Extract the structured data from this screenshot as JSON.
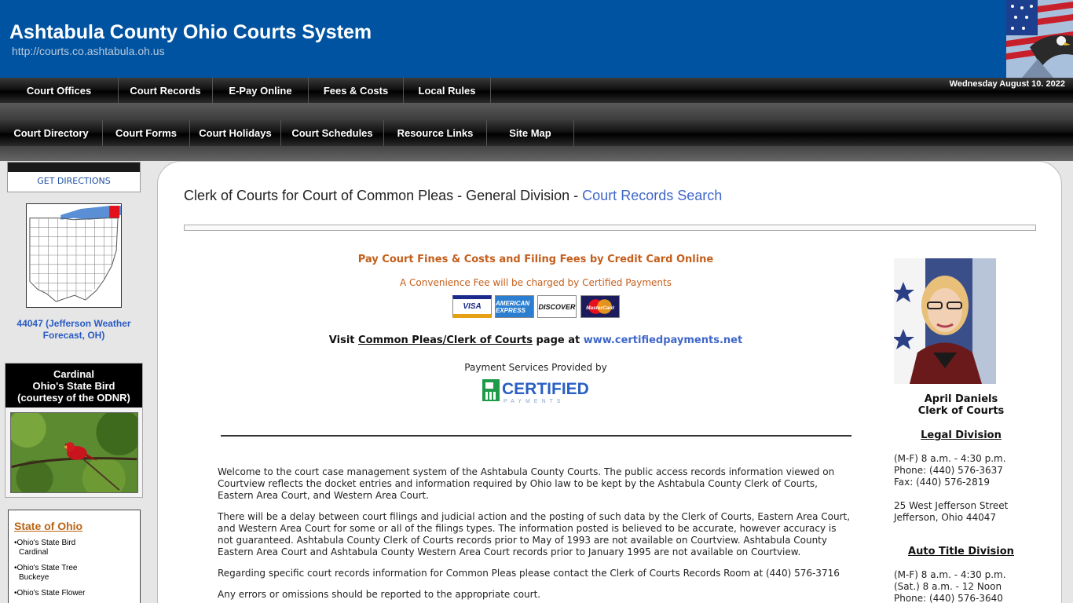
{
  "header": {
    "title": "Ashtabula County Ohio Courts System",
    "url": "http://courts.co.ashtabula.oh.us",
    "date": "Wednesday August 10. 2022"
  },
  "nav_primary": [
    "Court Offices",
    "Court Records",
    "E-Pay Online",
    "Fees & Costs",
    "Local Rules"
  ],
  "nav_secondary": [
    "Court Directory",
    "Court Forms",
    "Court Holidays",
    "Court Schedules",
    "Resource Links",
    "Site Map"
  ],
  "sidebar": {
    "directions": "GET DIRECTIONS",
    "weather": "44047 (Jefferson Weather Forecast, OH)",
    "bird_title_1": "Cardinal",
    "bird_title_2": "Ohio's State Bird",
    "bird_title_3": "(courtesy of the ODNR)",
    "state_title": "State of Ohio",
    "state_items": [
      {
        "label": "•Ohio's State Bird",
        "value": "Cardinal"
      },
      {
        "label": "•Ohio's State Tree",
        "value": "Buckeye"
      },
      {
        "label": "•Ohio's State Flower",
        "value": ""
      }
    ]
  },
  "main": {
    "heading_prefix": "Clerk of Courts for Court of Common Pleas - General Division - ",
    "heading_link": "Court Records Search",
    "pay_title": "Pay Court Fines & Costs and Filing Fees by Credit Card Online",
    "fee_note": "A Convenience Fee will be charged by Certified Payments",
    "cards": {
      "visa": "VISA",
      "amex": "AMERICAN EXPRESS",
      "discover": "DISCOVER",
      "mastercard": "MasterCard"
    },
    "visit_prefix": "Visit ",
    "visit_link": "Common Pleas/Clerk of Courts",
    "visit_middle": " page at ",
    "visit_site": "www.certifiedpayments.net",
    "provided_by": "Payment Services Provided by",
    "certified_word": "CERTIFIED",
    "certified_sub": "PAYMENTS",
    "paragraphs": [
      "Welcome to the court case management system of the Ashtabula County Courts. The public access records information viewed on Courtview reflects the docket entries and information required by Ohio law to be kept by the Ashtabula County Clerk of Courts, Eastern Area Court, and Western Area Court.",
      "There will be a delay between court filings and judicial action and the posting of such data by the Clerk of Courts, Eastern Area Court, and Western Area Court for some or all of the filings types. The information posted is believed to be accurate, however accuracy is not guaranteed. Ashtabula County Clerk of Courts records prior to May of 1993 are not available on Courtview. Ashtabula County Eastern Area Court and Ashtabula County Western Area Court records prior to January 1995 are not available on Courtview.",
      "Regarding specific court records information for Common Pleas please contact the Clerk of Courts Records Room at (440) 576-3716",
      "Any errors or omissions should be reported to the appropriate court."
    ]
  },
  "right": {
    "clerk_name": "April Daniels",
    "clerk_title": "Clerk of Courts",
    "legal_title": "Legal Division",
    "legal_hours": "(M-F) 8 a.m. - 4:30 p.m.",
    "legal_phone": "Phone: (440) 576-3637",
    "legal_fax": "Fax: (440) 576-2819",
    "address_1": "25 West Jefferson Street",
    "address_2": "Jefferson, Ohio 44047",
    "auto_title": "Auto Title Division",
    "auto_hours_1": "(M-F) 8 a.m. - 4:30 p.m.",
    "auto_hours_2": "(Sat.) 8 a.m. - 12 Noon",
    "auto_phone": "Phone: (440) 576-3640"
  }
}
